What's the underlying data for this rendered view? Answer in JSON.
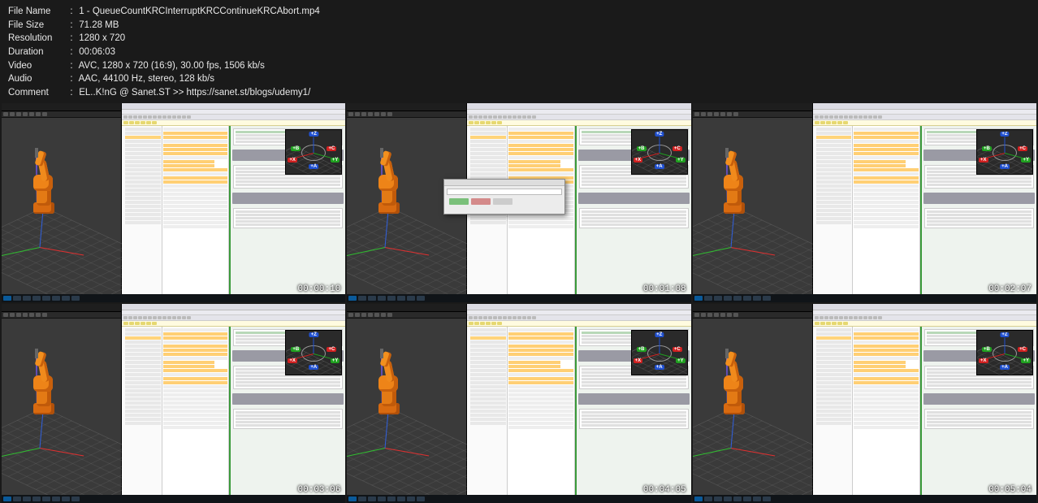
{
  "meta": {
    "labels": {
      "file_name": "File Name",
      "file_size": "File Size",
      "resolution": "Resolution",
      "duration": "Duration",
      "video": "Video",
      "audio": "Audio",
      "comment": "Comment"
    },
    "sep": ":",
    "file_name": "1 - QueueCountKRCInterruptKRCContinueKRCAbort.mp4",
    "file_size": "71.28 MB",
    "resolution": "1280 x 720",
    "duration": "00:06:03",
    "video": "AVC, 1280 x 720 (16:9), 30.00 fps, 1506 kb/s",
    "audio": "AAC, 44100 Hz, stereo, 128 kb/s",
    "comment": "EL..K!nG @ Sanet.ST >> https://sanet.st/blogs/udemy1/"
  },
  "gizmo": {
    "z": "+Z",
    "b": "+B",
    "c": "+C",
    "x": "+X",
    "y": "+Y",
    "a": "+A"
  },
  "thumbnails": [
    {
      "ts": "00:00:10",
      "dialog": false
    },
    {
      "ts": "00:01:08",
      "dialog": true
    },
    {
      "ts": "00:02:07",
      "dialog": false
    },
    {
      "ts": "00:03:06",
      "dialog": false
    },
    {
      "ts": "00:04:05",
      "dialog": false
    },
    {
      "ts": "00:05:04",
      "dialog": false
    }
  ]
}
